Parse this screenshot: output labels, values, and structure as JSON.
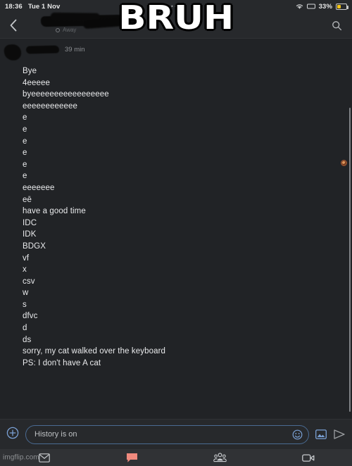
{
  "status_bar": {
    "time": "18:36",
    "date": "Tue 1 Nov",
    "center_dots": "•••",
    "wifi_icon": "wifi-icon",
    "device_icon": "tablet-icon",
    "battery_percent": "33%",
    "battery_icon": "battery-icon",
    "battery_level": 35,
    "battery_fill_color": "#f5c518"
  },
  "header": {
    "back_icon": "back-chevron-icon",
    "contact_name": "",
    "contact_name_redacted": true,
    "presence_status": "Away",
    "presence_icon": "away-circle-icon",
    "search_icon": "search-icon"
  },
  "meme_overlay": {
    "text": "BRUH",
    "fill_color": "#ffffff",
    "outline_color": "#000000"
  },
  "conversation": {
    "sender_name": "",
    "sender_name_redacted": true,
    "avatar_redacted": true,
    "timestamp": "39 min",
    "messages": [
      "Bye",
      "4eeeee",
      "byeeeeeeeeeeeeeeeee",
      "eeeeeeeeeeee",
      "e",
      "e",
      "e",
      "e",
      "e",
      "e",
      "eeeeeee",
      "eē",
      "have a good time",
      "IDC",
      "IDK",
      "BDGX",
      "vf",
      "x",
      "csv",
      "w",
      "s",
      "dfvc",
      "d",
      "ds",
      "sorry, my cat walked over the keyboard",
      "PS: I don't have A cat"
    ],
    "reaction_icon": "reaction-avatar-icon",
    "scrollbar": "scrollbar-thumb"
  },
  "composer": {
    "add_icon": "plus-circle-icon",
    "placeholder": "History is on",
    "value": "",
    "emoji_icon": "emoji-face-icon",
    "image_icon": "image-icon",
    "send_icon": "send-arrow-icon",
    "accent_color": "#7aa0d4"
  },
  "bottom_nav": {
    "watermark": "imgflip.com",
    "items": [
      {
        "icon": "envelope-icon",
        "color": "#c7cacd"
      },
      {
        "icon": "chat-bubble-icon",
        "color": "#f08a7e"
      },
      {
        "icon": "people-group-icon",
        "color": "#c7cacd"
      },
      {
        "icon": "video-camera-icon",
        "color": "#c7cacd"
      }
    ]
  }
}
